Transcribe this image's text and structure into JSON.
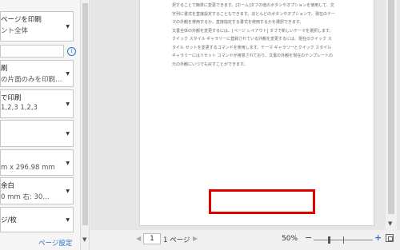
{
  "settings": [
    {
      "id": "print-range",
      "line1": "ページを印刷",
      "line2": "ント全体"
    },
    {
      "id": "sides",
      "line1": "刷",
      "line2": "の片面のみを印刷…"
    },
    {
      "id": "collate",
      "line1": "で印刷",
      "line2": "1,2,3    1,2,3"
    },
    {
      "id": "orientation",
      "line1": "",
      "line2": ""
    },
    {
      "id": "paper-size",
      "line1": "",
      "line2": "m x 296.98 mm"
    },
    {
      "id": "margins",
      "line1": "余白",
      "line2": "0 mm    右:  30…"
    },
    {
      "id": "pages-per-sheet",
      "line1": "ジ/枚",
      "line2": ""
    }
  ],
  "pages_input": {
    "value": ""
  },
  "page_setup_link": "ページ設定",
  "paper_lines": [
    "択することで簡単に変更できます。[ホーム]タブの他のボタンやオプションを使用して、文",
    "字列に書式を直接設定することもできます。ほとんどのボタンやオプションで、現在のテー",
    "マの外観を使用するか、直接指定する書式を使用するかを選択できます。",
    "文書全体の外観を変更するには、[ページ レイアウト] タブで新しいテーマを選択します。",
    "クイック スタイル ギャラリーに登録されている外観を変更するには、現在のクイック ス",
    "タイル セットを変更するコマンドを使用します。テーマ ギャラリーとクイック スタイル",
    "ギャラリーにはリセット コマンドが用意されており、文書の外観を現在のテンプレートの",
    "元の外観にいつでも戻すことができます。"
  ],
  "navigation": {
    "prev_glyph": "◀",
    "next_glyph": "▶",
    "page_number": "1",
    "page_total": "1 ページ"
  },
  "zoom": {
    "percent": "50%",
    "level": 0.25,
    "minus": "−",
    "plus": "+"
  },
  "colors": {
    "highlight": "#e00000",
    "link": "#2a6fbf"
  }
}
